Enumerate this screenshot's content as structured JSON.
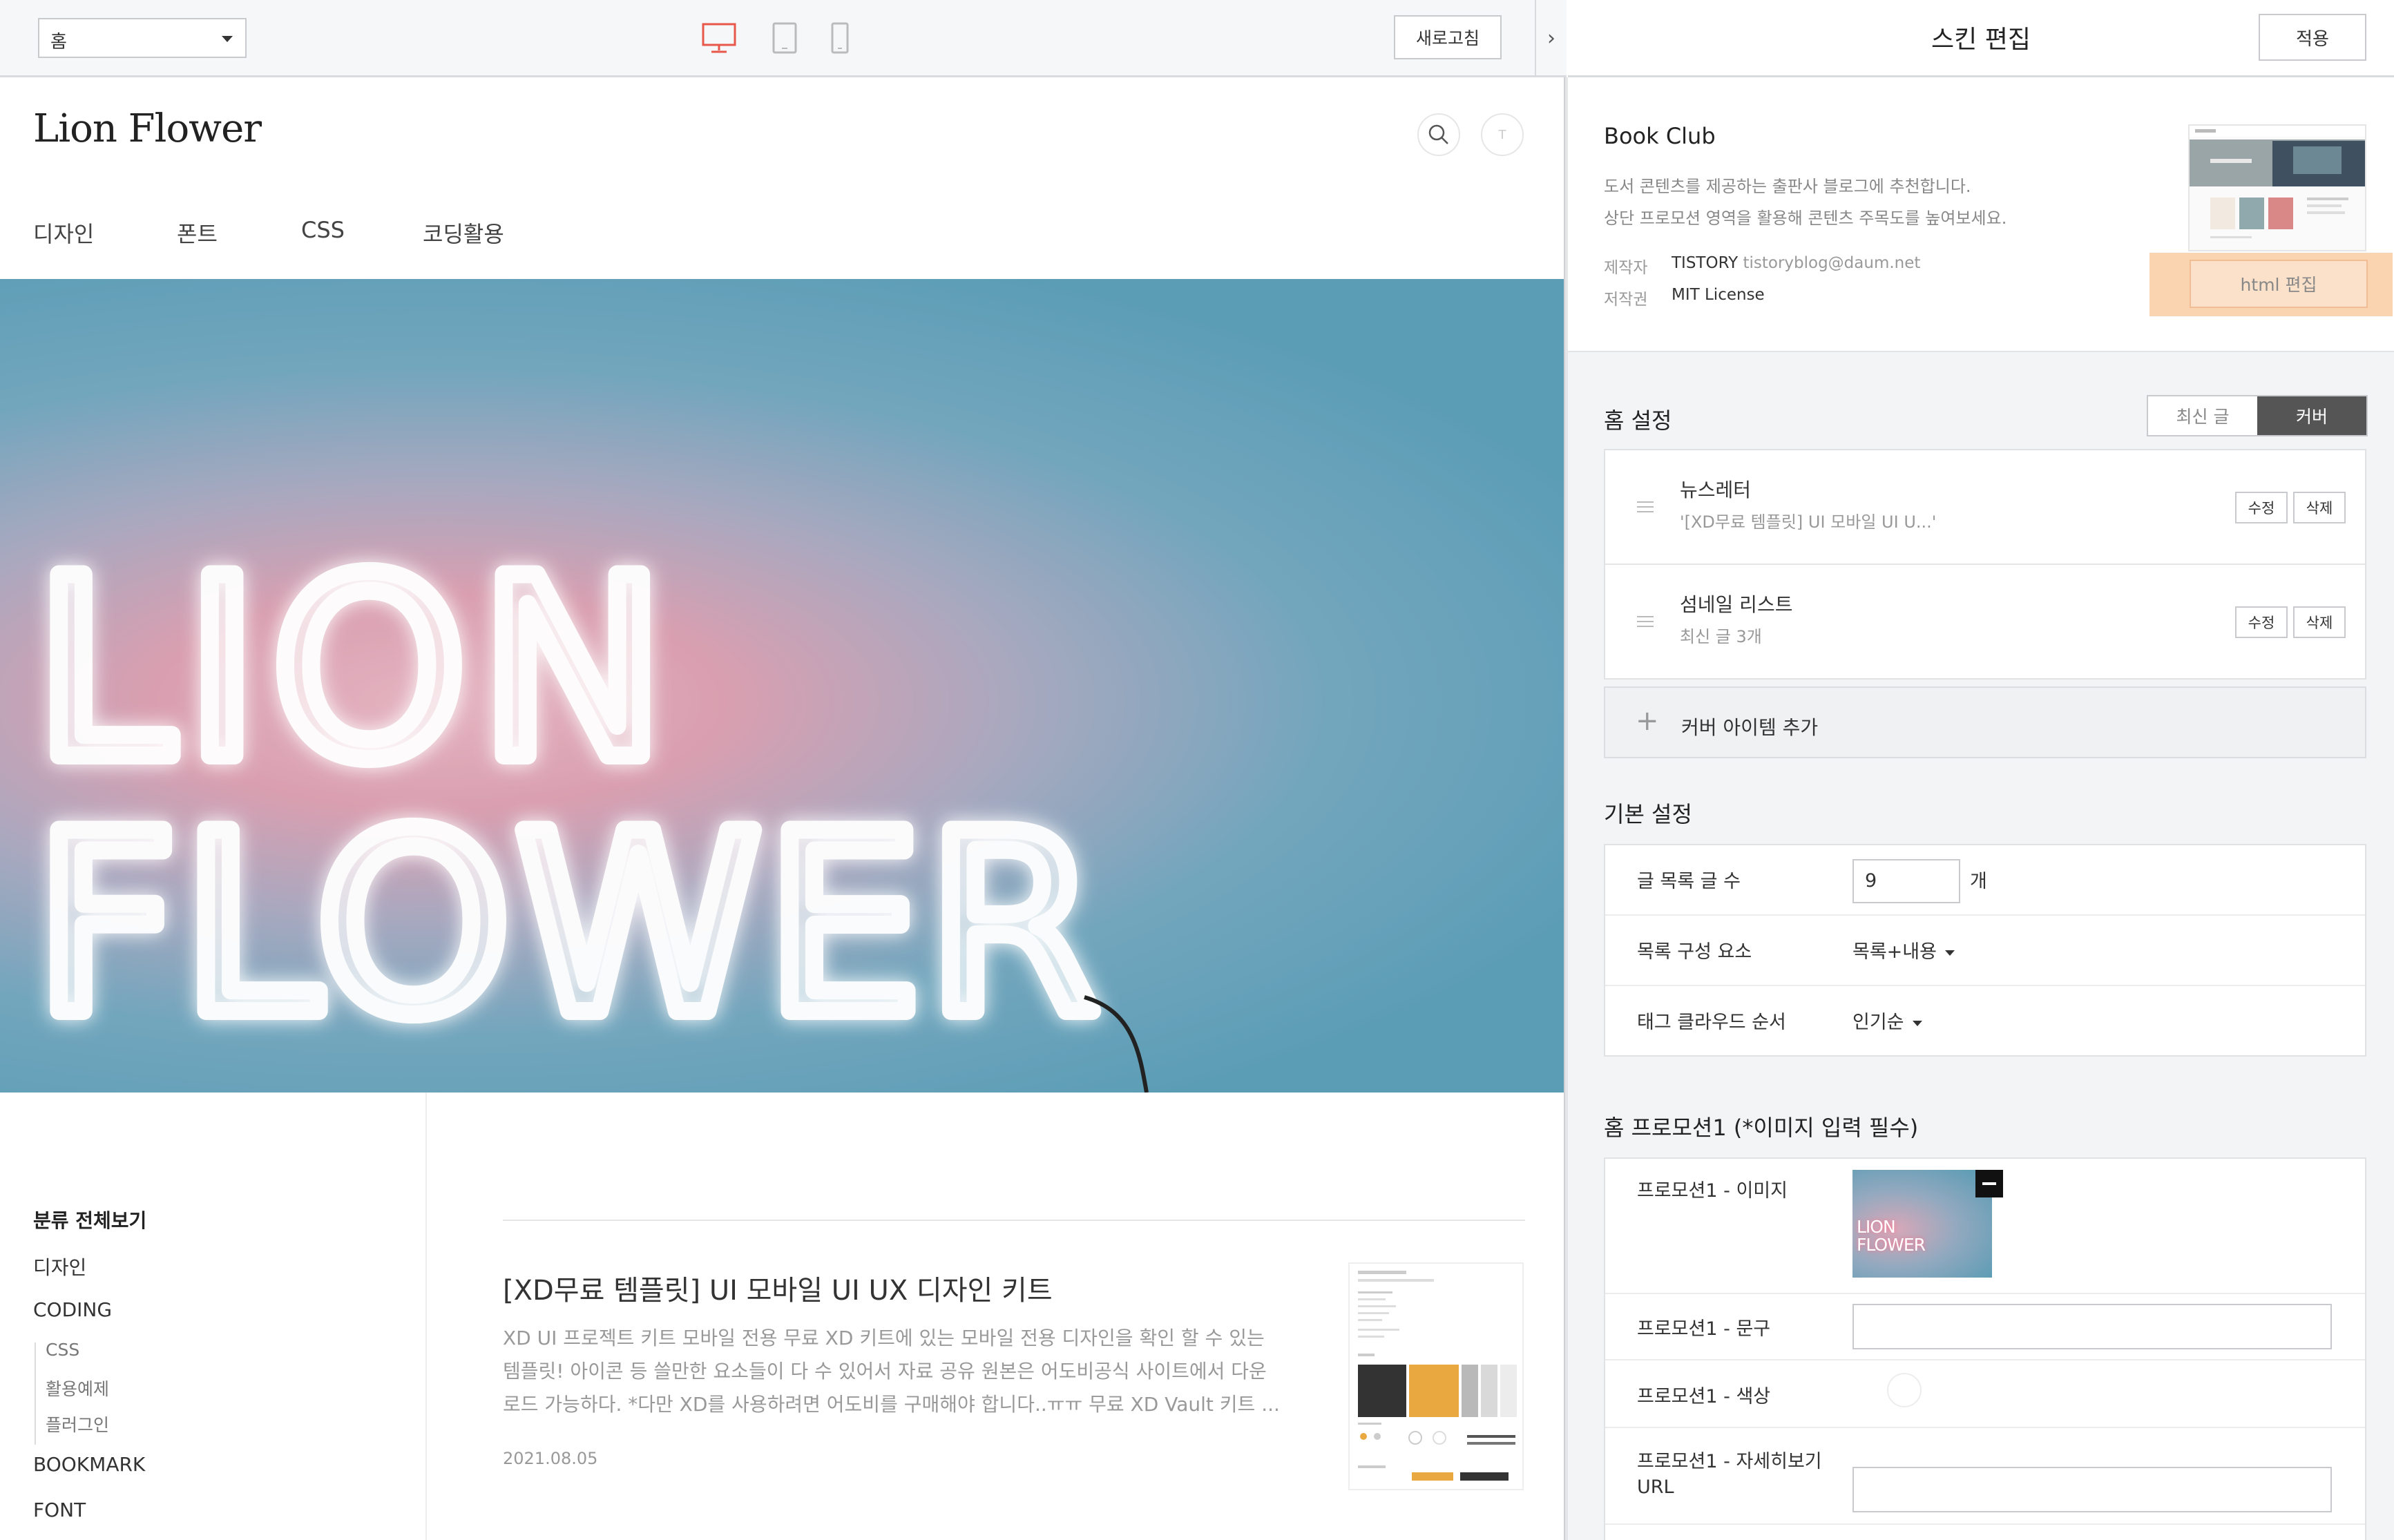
{
  "toolbar": {
    "page_select_value": "홈",
    "refresh_label": "새로고침",
    "collapse_icon": "›",
    "device_icons": [
      "desktop-icon",
      "tablet-icon",
      "mobile-icon"
    ],
    "active_device_color": "#e8584a"
  },
  "blog": {
    "title": "Lion Flower",
    "avatar_letter": "T",
    "nav": [
      "디자인",
      "폰트",
      "CSS",
      "코딩활용"
    ],
    "hero_text_line1": "LION",
    "hero_text_line2": "FLOWER",
    "categories": {
      "all_label": "분류 전체보기",
      "items": [
        "디자인",
        "CODING"
      ],
      "coding_sub": [
        "CSS",
        "활용예제",
        "플러그인"
      ],
      "more": [
        "BOOKMARK",
        "FONT"
      ]
    },
    "post": {
      "title": "[XD무료 템플릿] UI 모바일 UI UX 디자인 키트",
      "excerpt_lines": [
        "XD UI 프로젝트 키트 모바일 전용  무료 XD 키트에 있는 모바일 전용 디자인을 확인 할 수 있는",
        "템플릿! 아이콘 등 쓸만한 요소들이 다 수 있어서 자료 공유 원본은 어도비공식 사이트에서 다운",
        "로드 가능하다. *다만 XD를 사용하려면 어도비를 구매해야 합니다..ㅠㅠ 무료 XD Vault 키트 ..."
      ],
      "date": "2021.08.05"
    }
  },
  "editor": {
    "title": "스킨 편집",
    "apply_label": "적용",
    "skin": {
      "name": "Book Club",
      "desc_lines": [
        "도서 콘텐츠를 제공하는 출판사 블로그에 추천합니다.",
        "상단 프로모션 영역을 활용해 콘텐츠 주목도를 높여보세요."
      ],
      "maker_label": "제작자",
      "maker_value": "TISTORY",
      "maker_email": "tistoryblog@daum.net",
      "license_label": "저작권",
      "license_value": "MIT License",
      "html_edit_label": "html 편집",
      "highlight_color": "#fad3b1"
    },
    "home_settings": {
      "title": "홈 설정",
      "tab_recent": "최신 글",
      "tab_cover": "커버",
      "items": [
        {
          "name": "뉴스레터",
          "sub": "'[XD무료 템플릿] UI 모바일 UI U...'",
          "edit": "수정",
          "delete": "삭제"
        },
        {
          "name": "섬네일 리스트",
          "sub": "최신 글 3개",
          "edit": "수정",
          "delete": "삭제"
        }
      ],
      "add_label": "커버 아이템 추가",
      "add_icon": "+"
    },
    "basic_settings": {
      "title": "기본 설정",
      "post_count_label": "글 목록 글 수",
      "post_count_value": "9",
      "post_count_unit": "개",
      "list_elements_label": "목록 구성 요소",
      "list_elements_value": "목록+내용",
      "tag_cloud_label": "태그 클라우드 순서",
      "tag_cloud_value": "인기순"
    },
    "promotion": {
      "title": "홈 프로모션1 (*이미지 입력 필수)",
      "image_label": "프로모션1 - 이미지",
      "image_thumb_text": "LION\nFLOWER",
      "text_label": "프로모션1 - 문구",
      "text_value": "",
      "color_label": "프로모션1 - 색상",
      "url_label_line1": "프로모션1 - 자세히보기",
      "url_label_line2": "URL",
      "url_value": ""
    }
  }
}
